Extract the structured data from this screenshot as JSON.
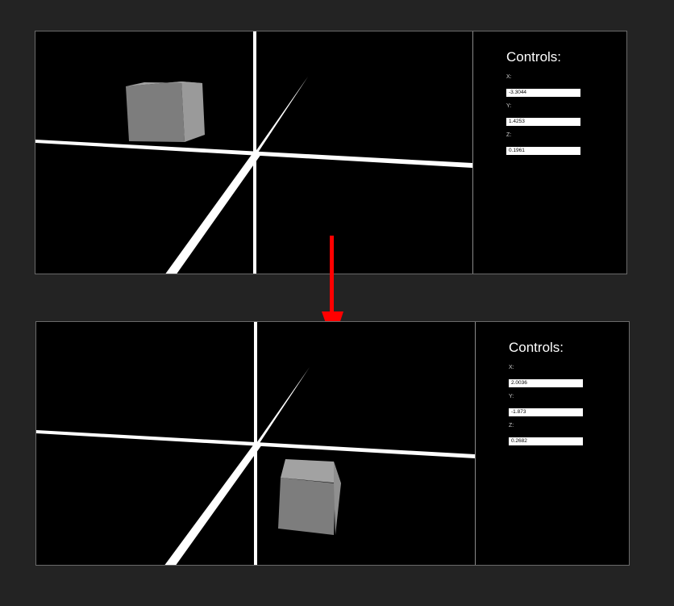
{
  "before": {
    "controls": {
      "title": "Controls:",
      "x_label": "X:",
      "x_value": "-3.3044",
      "y_label": "Y:",
      "y_value": "1.4253",
      "z_label": "Z:",
      "z_value": "0.1961"
    }
  },
  "after": {
    "controls": {
      "title": "Controls:",
      "x_label": "X:",
      "x_value": "2.0036",
      "y_label": "Y:",
      "y_value": "-1.873",
      "z_label": "Z:",
      "z_value": "0.2682"
    }
  },
  "colors": {
    "page_background": "#232323",
    "viewport_background": "#000000",
    "axis_lines": "#ffffff",
    "cube": "#808080",
    "arrow": "#ff0000"
  },
  "icons": {
    "transition": "down-arrow-icon"
  }
}
